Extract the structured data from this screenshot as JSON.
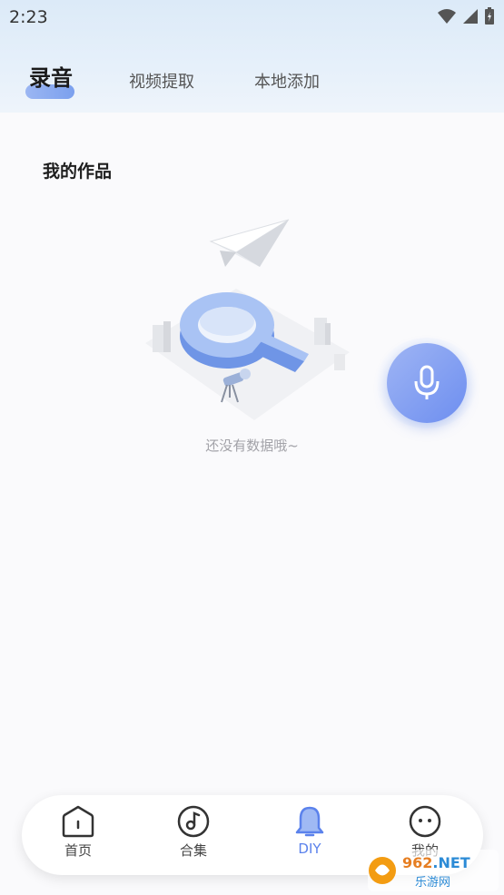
{
  "status_bar": {
    "time": "2:23"
  },
  "tabs": [
    {
      "label": "录音",
      "active": true
    },
    {
      "label": "视频提取",
      "active": false
    },
    {
      "label": "本地添加",
      "active": false
    }
  ],
  "section": {
    "title": "我的作品"
  },
  "empty_state": {
    "text": "还没有数据哦~"
  },
  "bottom_nav": [
    {
      "label": "首页",
      "icon": "home-icon",
      "active": false
    },
    {
      "label": "合集",
      "icon": "music-note-icon",
      "active": false
    },
    {
      "label": "DIY",
      "icon": "bell-icon",
      "active": true
    },
    {
      "label": "我的",
      "icon": "smiley-icon",
      "active": false
    }
  ],
  "watermark": {
    "text_top": "962",
    "text_top_suffix": ".NET",
    "text_bottom": "乐游网"
  },
  "colors": {
    "accent": "#5b82ec",
    "header_bg": "#dceaf8",
    "mic": "#7b9cf0"
  }
}
